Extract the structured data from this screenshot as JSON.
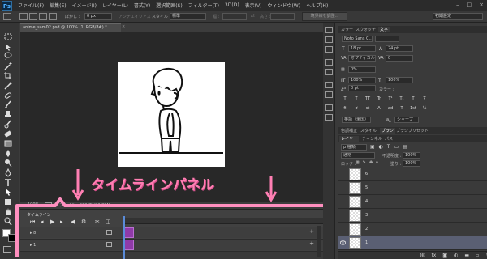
{
  "app": {
    "logo": "Ps"
  },
  "menu": [
    "ファイル(F)",
    "編集(E)",
    "イメージ(I)",
    "レイヤー(L)",
    "書式(Y)",
    "選択範囲(S)",
    "フィルター(T)",
    "3D(D)",
    "表示(V)",
    "ウィンドウ(W)",
    "ヘルプ(H)"
  ],
  "window_controls": [
    "–",
    "□",
    "×"
  ],
  "options_bar": {
    "feather_label": "ぼかし :",
    "feather_value": "0 px",
    "antialias_label": "アンチエイリアス",
    "style_label": "スタイル :",
    "style_value": "標準",
    "width_label": "幅 :",
    "height_label": "高さ :",
    "refine_button": "境界線を調整...",
    "workspace": "初期設定"
  },
  "document": {
    "tab_title": "anime_sam02.psd @ 100% (1, RGB/8#) *",
    "zoom": "100%",
    "doc_size": "ファイル : 263.7K/23.88M"
  },
  "timeline": {
    "tab": "タイムライン",
    "tracks": [
      {
        "label": "▸ 8"
      },
      {
        "label": "▸ 1"
      }
    ]
  },
  "annotation": {
    "text": "タイムラインパネル",
    "color": "#ff7fb3"
  },
  "character_panel": {
    "tabs": [
      "カラー",
      "スウォッチ",
      "文字"
    ],
    "font_family": "Noto Sans C...",
    "font_size": "18 pt",
    "leading": "24 pt",
    "kerning": "オプティカル",
    "tracking": "0",
    "tsume": "0%",
    "vscale": "100%",
    "hscale": "100%",
    "baseline": "0 pt",
    "color_label": "カラー :",
    "style_buttons": [
      "T",
      "T",
      "TT",
      "Tr",
      "T¹",
      "T₁",
      "T",
      "Ŧ"
    ],
    "ot_buttons": [
      "fi",
      "ơ",
      "st",
      "A",
      "ad",
      "T",
      "1st",
      "½"
    ],
    "language": "英語（米国）",
    "aa": "シャープ"
  },
  "properties_tabs": [
    "色調補正",
    "スタイル",
    "ブラシ",
    "ブラシプリセット"
  ],
  "layers_panel": {
    "tabs": [
      "レイヤー",
      "チャンネル",
      "パス"
    ],
    "filter_label": "ρ 種類",
    "blend_mode": "通常",
    "opacity_label": "不透明度 :",
    "opacity_value": "100%",
    "lock_label": "ロック :",
    "fill_label": "塗り :",
    "fill_value": "100%",
    "layers": [
      {
        "name": "6"
      },
      {
        "name": "5"
      },
      {
        "name": "4"
      },
      {
        "name": "3"
      },
      {
        "name": "2"
      },
      {
        "name": "1",
        "selected": true
      }
    ],
    "footer_icons": [
      "link-icon",
      "fx-icon",
      "mask-icon",
      "adjust-icon",
      "folder-icon",
      "new-layer-icon",
      "trash-icon"
    ]
  }
}
